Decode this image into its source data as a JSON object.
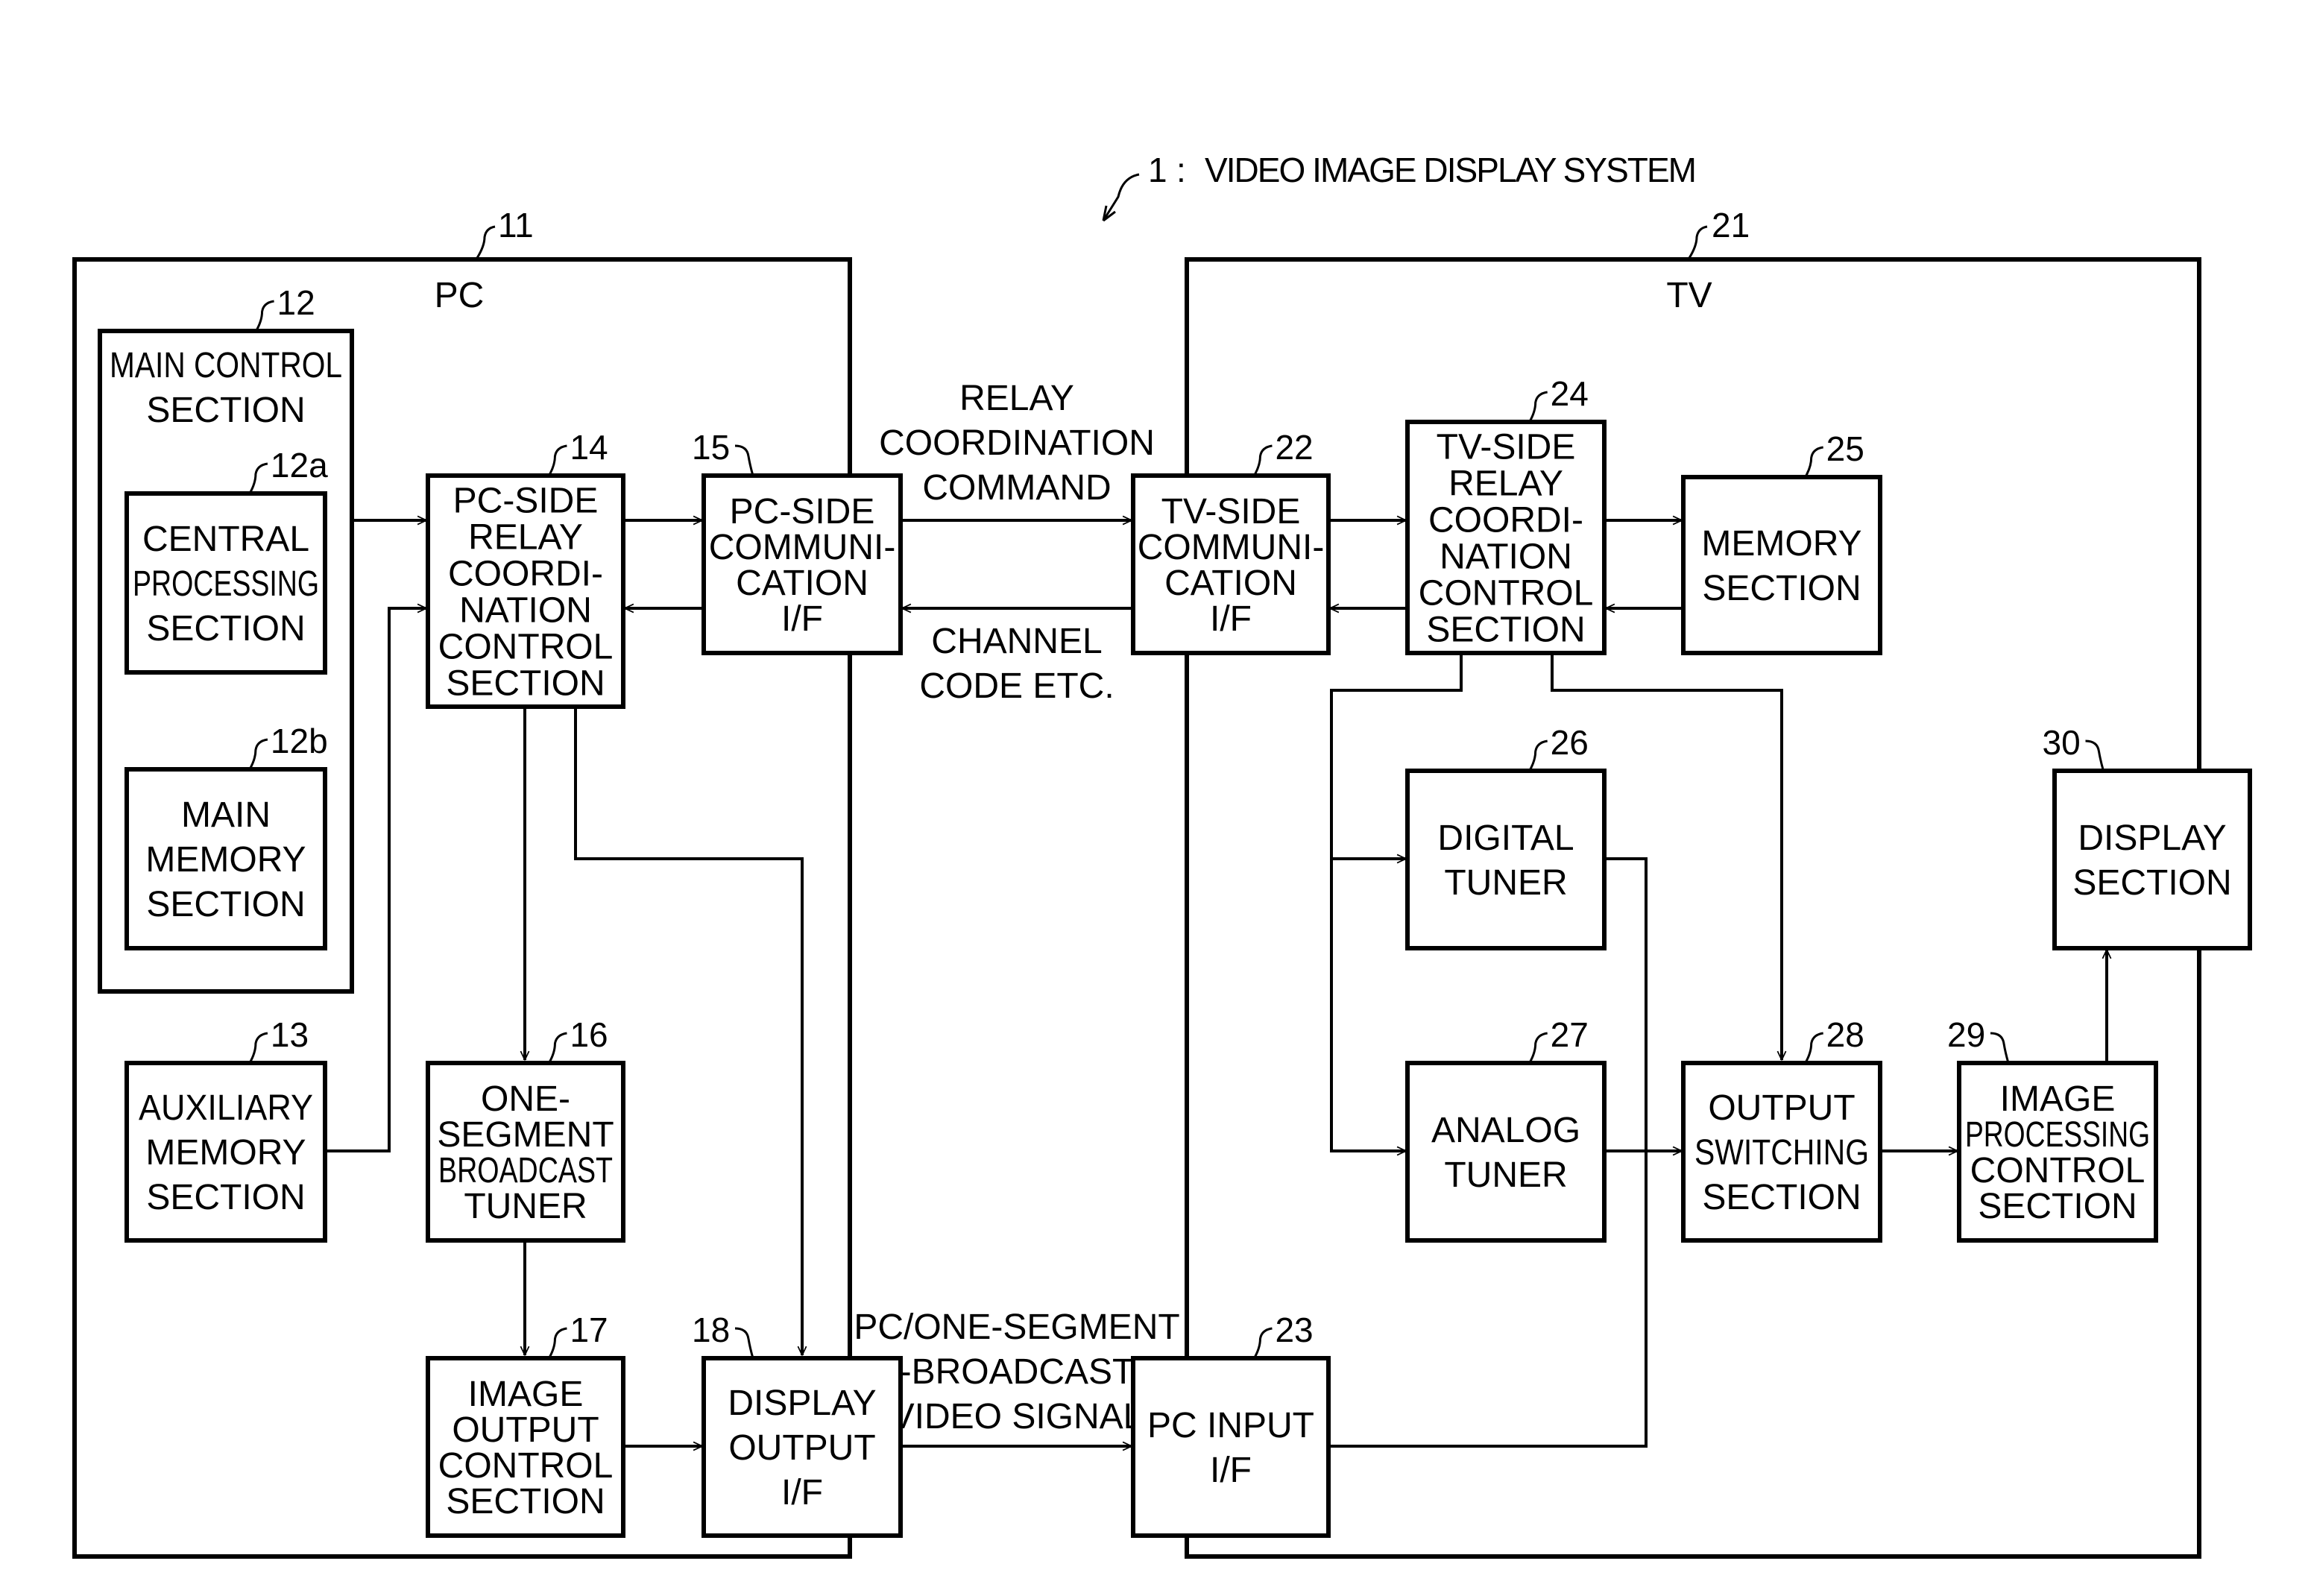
{
  "title": {
    "ref": "1",
    "separator": ":",
    "text": "VIDEO IMAGE DISPLAY SYSTEM"
  },
  "devices": {
    "pc": {
      "ref": "11",
      "label": "PC"
    },
    "tv": {
      "ref": "21",
      "label": "TV"
    }
  },
  "blocks": {
    "b12": {
      "ref": "12",
      "lines": [
        "MAIN CONTROL",
        "SECTION"
      ]
    },
    "b12a": {
      "ref": "12a",
      "lines": [
        "CENTRAL",
        "PROCESSING",
        "SECTION"
      ]
    },
    "b12b": {
      "ref": "12b",
      "lines": [
        "MAIN",
        "MEMORY",
        "SECTION"
      ]
    },
    "b13": {
      "ref": "13",
      "lines": [
        "AUXILIARY",
        "MEMORY",
        "SECTION"
      ]
    },
    "b14": {
      "ref": "14",
      "lines": [
        "PC-SIDE",
        "RELAY",
        "COORDI-",
        "NATION",
        "CONTROL",
        "SECTION"
      ]
    },
    "b15": {
      "ref": "15",
      "lines": [
        "PC-SIDE",
        "COMMUNI-",
        "CATION",
        "I/F"
      ]
    },
    "b16": {
      "ref": "16",
      "lines": [
        "ONE-",
        "SEGMENT",
        "BROADCAST",
        "TUNER"
      ]
    },
    "b17": {
      "ref": "17",
      "lines": [
        "IMAGE",
        "OUTPUT",
        "CONTROL",
        "SECTION"
      ]
    },
    "b18": {
      "ref": "18",
      "lines": [
        "DISPLAY",
        "OUTPUT",
        "I/F"
      ]
    },
    "b22": {
      "ref": "22",
      "lines": [
        "TV-SIDE",
        "COMMUNI-",
        "CATION",
        "I/F"
      ]
    },
    "b23": {
      "ref": "23",
      "lines": [
        "PC INPUT",
        "I/F"
      ]
    },
    "b24": {
      "ref": "24",
      "lines": [
        "TV-SIDE",
        "RELAY",
        "COORDI-",
        "NATION",
        "CONTROL",
        "SECTION"
      ]
    },
    "b25": {
      "ref": "25",
      "lines": [
        "MEMORY",
        "SECTION"
      ]
    },
    "b26": {
      "ref": "26",
      "lines": [
        "DIGITAL",
        "TUNER"
      ]
    },
    "b27": {
      "ref": "27",
      "lines": [
        "ANALOG",
        "TUNER"
      ]
    },
    "b28": {
      "ref": "28",
      "lines": [
        "OUTPUT",
        "SWITCHING",
        "SECTION"
      ]
    },
    "b29": {
      "ref": "29",
      "lines": [
        "IMAGE",
        "PROCESSING",
        "CONTROL",
        "SECTION"
      ]
    },
    "b30": {
      "ref": "30",
      "lines": [
        "DISPLAY",
        "SECTION"
      ]
    }
  },
  "signals": {
    "relay_command": [
      "RELAY",
      "COORDINATION",
      "COMMAND"
    ],
    "channel_code": [
      "CHANNEL",
      "CODE ETC."
    ],
    "video_signal": [
      "PC/ONE-SEGMENT",
      "-BROADCAST",
      "VIDEO SIGNAL"
    ]
  }
}
